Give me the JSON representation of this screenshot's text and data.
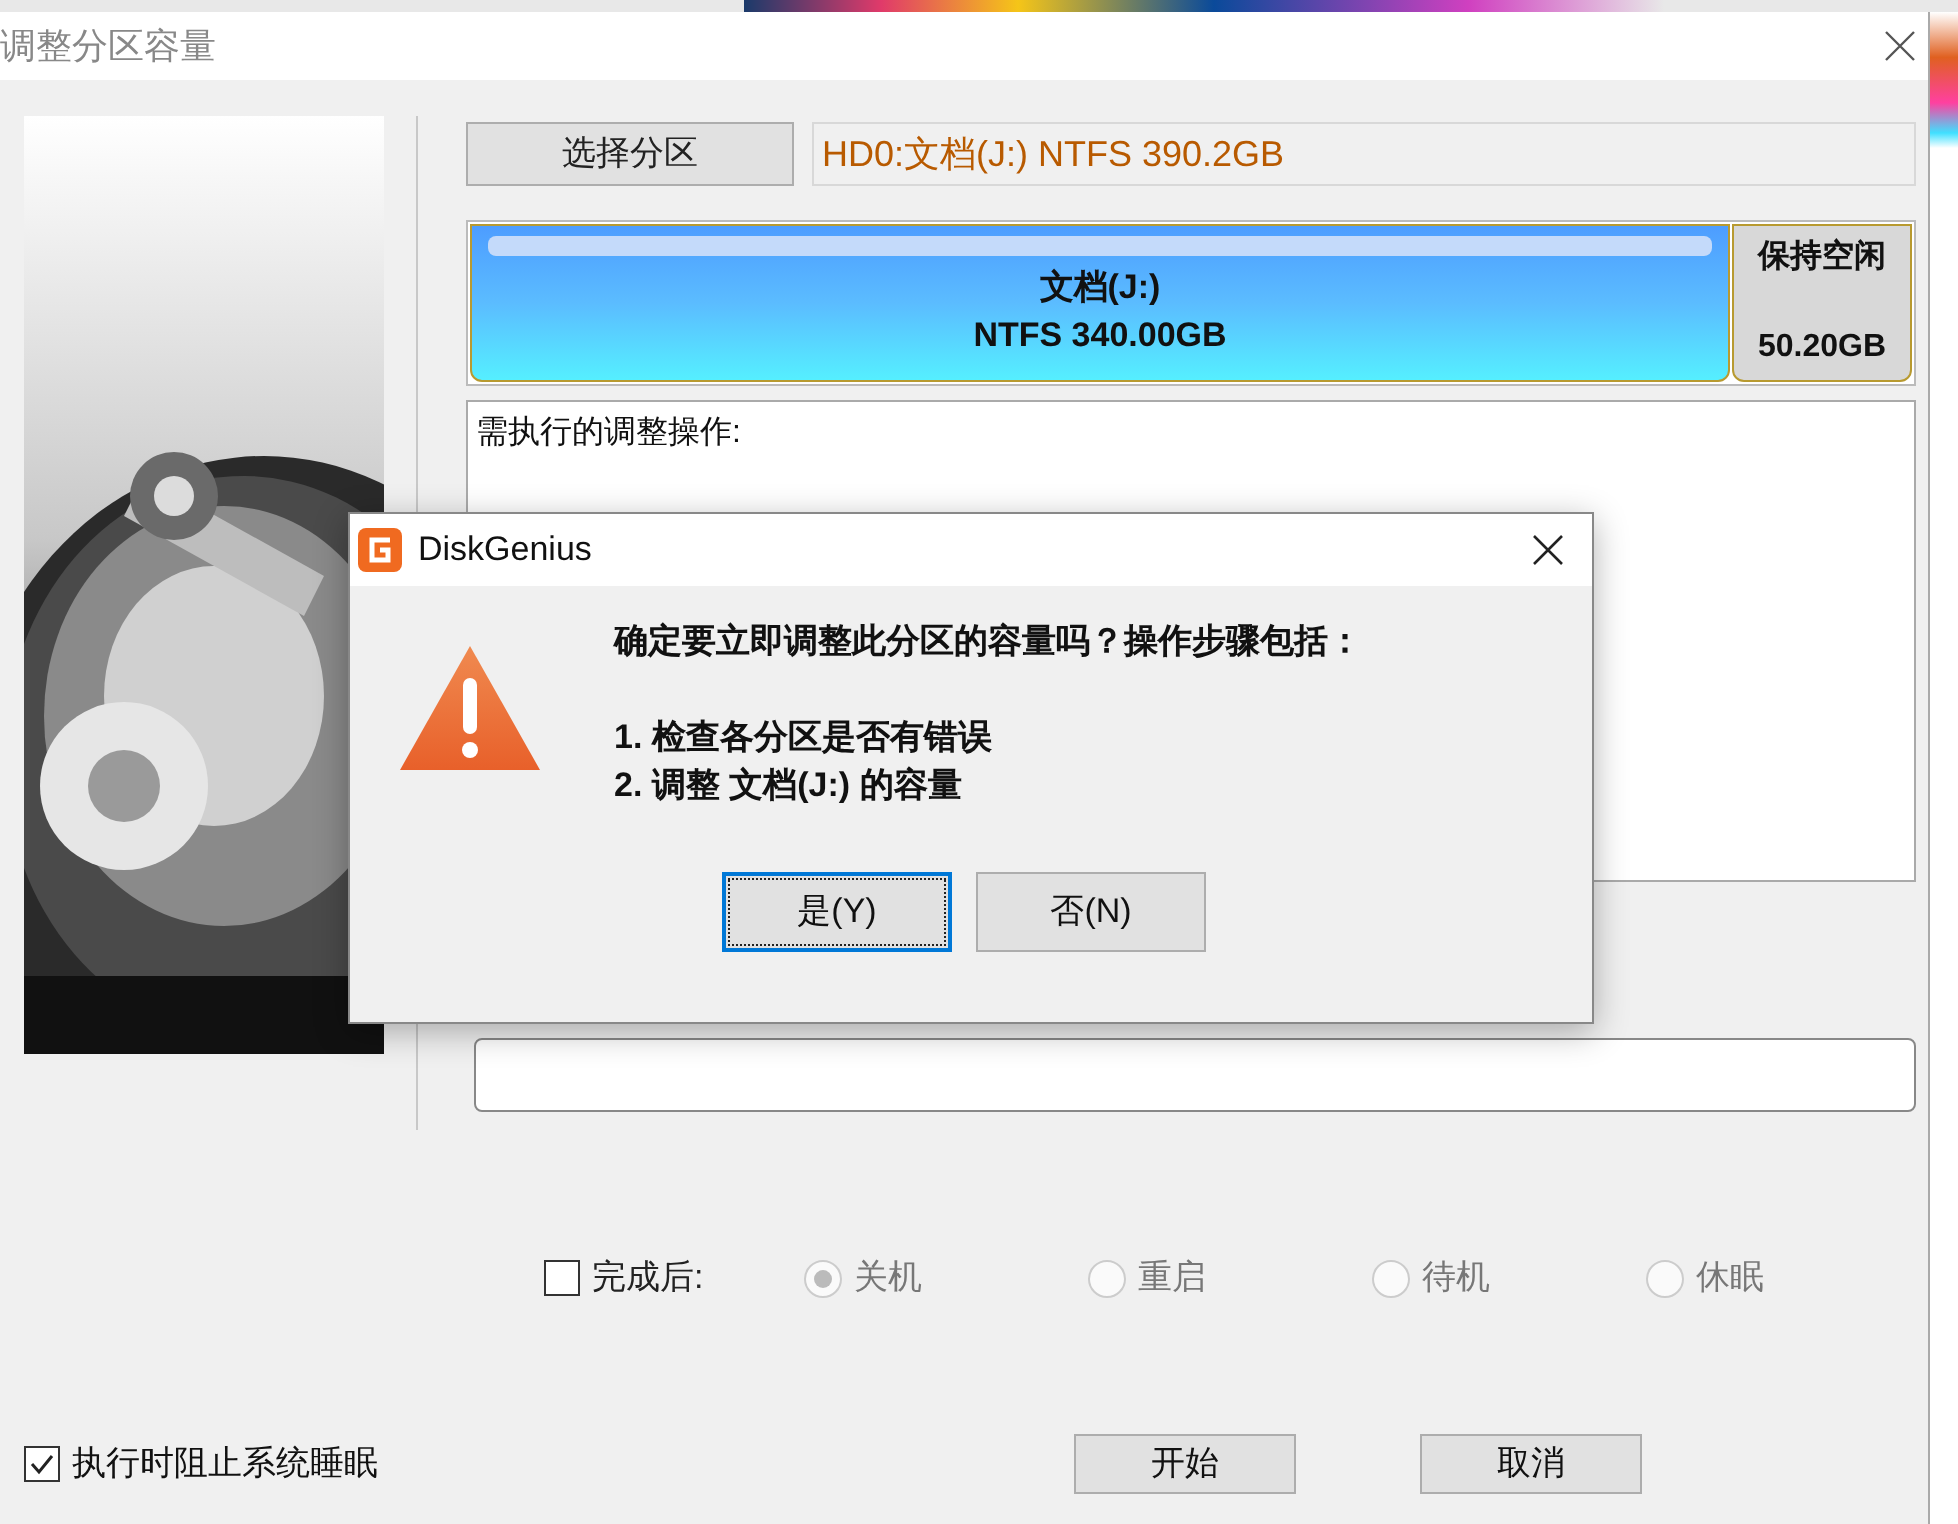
{
  "window": {
    "title": "调整分区容量"
  },
  "select_partition_button": "选择分区",
  "partition_field": "HD0:文档(J:) NTFS 390.2GB",
  "partition_map": [
    {
      "kind": "partition",
      "name": "文档(J:)",
      "size": "NTFS 340.00GB"
    },
    {
      "kind": "free",
      "name": "保持空闲",
      "size": "50.20GB"
    }
  ],
  "operations": {
    "heading": "需执行的调整操作:"
  },
  "after_completion": {
    "label": "完成后:",
    "checked": false,
    "options": [
      {
        "label": "关机",
        "selected": true,
        "disabled": true
      },
      {
        "label": "重启",
        "selected": false,
        "disabled": true
      },
      {
        "label": "待机",
        "selected": false,
        "disabled": true
      },
      {
        "label": "休眠",
        "selected": false,
        "disabled": true
      }
    ]
  },
  "prevent_sleep": {
    "label": "执行时阻止系统睡眠",
    "checked": true
  },
  "buttons": [
    {
      "label": "开始"
    },
    {
      "label": "取消"
    }
  ],
  "dialog": {
    "title": "DiskGenius",
    "message": "确定要立即调整此分区的容量吗？操作步骤包括：",
    "steps": [
      "1. 检查各分区是否有错误",
      "2. 调整 文档(J:) 的容量"
    ],
    "buttons": [
      {
        "label": "是(Y)",
        "focused": true
      },
      {
        "label": "否(N)",
        "focused": false
      }
    ]
  }
}
